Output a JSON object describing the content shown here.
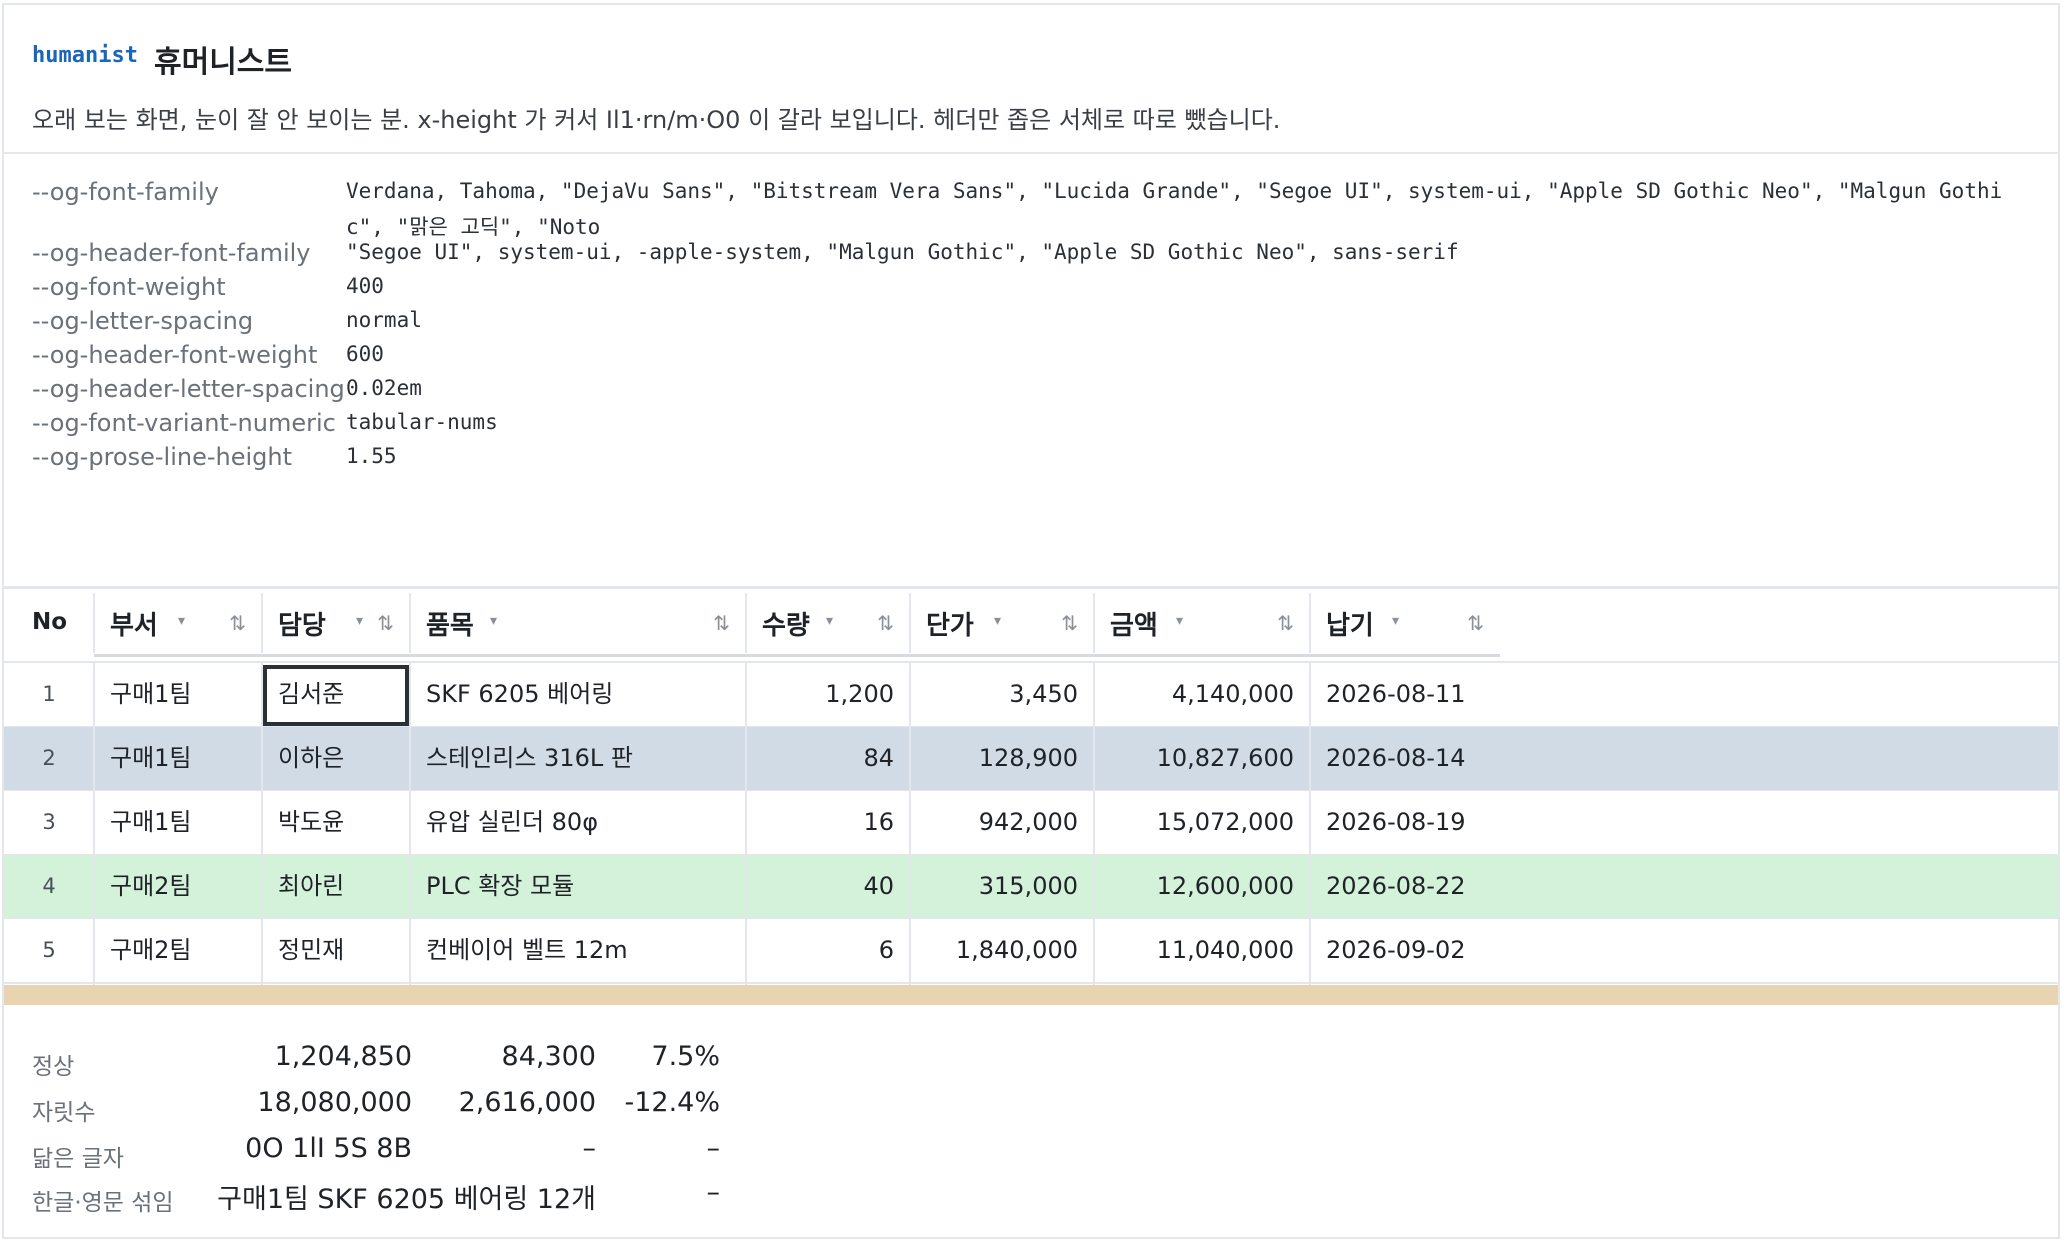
{
  "header": {
    "tag": "humanist",
    "title": "휴머니스트",
    "description": "오래 보는 화면, 눈이 잘 안 보이는 분. x-height 가 커서 Il1·rn/m·O0 이 갈라 보입니다. 헤더만 좁은 서체로 따로 뺐습니다."
  },
  "variables": [
    {
      "name": "--og-font-family",
      "value": "Verdana, Tahoma, \"DejaVu Sans\", \"Bitstream Vera Sans\", \"Lucida Grande\", \"Segoe UI\", system-ui, \"Apple SD Gothic Neo\", \"Malgun Gothic\", \"맑은 고딕\", \"Noto"
    },
    {
      "name": "--og-header-font-family",
      "value": "\"Segoe UI\", system-ui, -apple-system, \"Malgun Gothic\", \"Apple SD Gothic Neo\", sans-serif"
    },
    {
      "name": "--og-font-weight",
      "value": "400"
    },
    {
      "name": "--og-letter-spacing",
      "value": "normal"
    },
    {
      "name": "--og-header-font-weight",
      "value": "600"
    },
    {
      "name": "--og-header-letter-spacing",
      "value": "0.02em"
    },
    {
      "name": "--og-font-variant-numeric",
      "value": "tabular-nums"
    },
    {
      "name": "--og-prose-line-height",
      "value": "1.55"
    }
  ],
  "grid": {
    "columns": [
      {
        "label": "No",
        "caret": "",
        "sort": ""
      },
      {
        "label": "부서",
        "caret": "▾",
        "sort": "⇅"
      },
      {
        "label": "담당",
        "caret": "▾",
        "sort": "⇅"
      },
      {
        "label": "품목",
        "caret": "▾",
        "sort": "⇅"
      },
      {
        "label": "수량",
        "caret": "▾",
        "sort": "⇅"
      },
      {
        "label": "단가",
        "caret": "▾",
        "sort": "⇅"
      },
      {
        "label": "금액",
        "caret": "▾",
        "sort": "⇅"
      },
      {
        "label": "납기",
        "caret": "▾",
        "sort": "⇅"
      }
    ],
    "rows": [
      {
        "no": "1",
        "dept": "구매1팀",
        "owner": "김서준",
        "item": "SKF 6205 베어링",
        "qty": "1,200",
        "price": "3,450",
        "amount": "4,140,000",
        "due": "2026-08-11",
        "bg": "#ffffff"
      },
      {
        "no": "2",
        "dept": "구매1팀",
        "owner": "이하은",
        "item": "스테인리스 316L 판",
        "qty": "84",
        "price": "128,900",
        "amount": "10,827,600",
        "due": "2026-08-14",
        "bg": "#d0dbe5"
      },
      {
        "no": "3",
        "dept": "구매1팀",
        "owner": "박도윤",
        "item": "유압 실린더 80φ",
        "qty": "16",
        "price": "942,000",
        "amount": "15,072,000",
        "due": "2026-08-19",
        "bg": "#ffffff"
      },
      {
        "no": "4",
        "dept": "구매2팀",
        "owner": "최아린",
        "item": "PLC 확장 모듈",
        "qty": "40",
        "price": "315,000",
        "amount": "12,600,000",
        "due": "2026-08-22",
        "bg": "#d4f2da"
      },
      {
        "no": "5",
        "dept": "구매2팀",
        "owner": "정민재",
        "item": "컨베이어 벨트 12m",
        "qty": "6",
        "price": "1,840,000",
        "amount": "11,040,000",
        "due": "2026-09-02",
        "bg": "#ffffff"
      }
    ]
  },
  "stats": [
    {
      "label": "정상",
      "a": "1,204,850",
      "b": "84,300",
      "c": "7.5%"
    },
    {
      "label": "자릿수",
      "a": "18,080,000",
      "b": "2,616,000",
      "c": "-12.4%"
    },
    {
      "label": "닮은 글자",
      "a": "0O 1lI 5S 8B",
      "b": "–",
      "c": "–"
    },
    {
      "label": "한글·영문 섞임",
      "a": "구매1팀 SKF 6205 베어링 12개",
      "b": "",
      "c": "–"
    }
  ],
  "colors": {
    "accent": "#1a66b8",
    "row_selected": "#d0dbe5",
    "row_highlight": "#d4f2da",
    "footer_bar": "#e8d4b0"
  }
}
